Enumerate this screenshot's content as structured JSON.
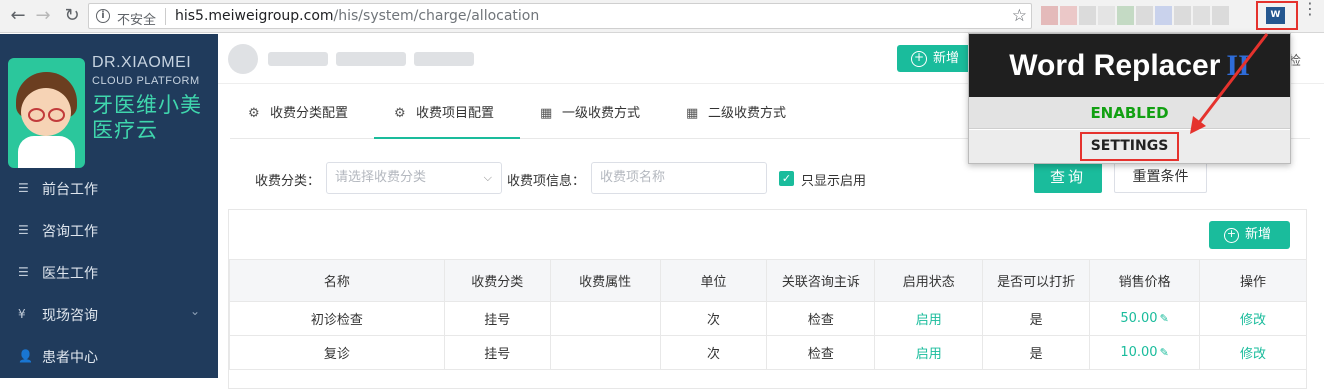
{
  "browser": {
    "back_icon": "←",
    "forward_icon": "→",
    "reload_icon": "↻",
    "info_icon": "i",
    "insecure_label": "不安全",
    "url_host": "his5.meiweigroup.com",
    "url_path": "/his/system/charge/allocation",
    "star_icon": "☆",
    "extension_icon": "W",
    "menu_icon": "⋮"
  },
  "brand": {
    "name_en_1": "DR.XIAOMEI",
    "name_en_2": "CLOUD PLATFORM",
    "name_cn_1": "牙医维小美",
    "name_cn_2": "医疗云"
  },
  "sidebar": {
    "items": [
      {
        "label": "前台工作",
        "icon": "list-icon"
      },
      {
        "label": "咨询工作",
        "icon": "list-icon"
      },
      {
        "label": "医生工作",
        "icon": "list-icon"
      },
      {
        "label": "现场咨询",
        "icon": "yen-icon"
      },
      {
        "label": "患者中心",
        "icon": "user-icon"
      }
    ]
  },
  "topbar": {
    "new_button": "新增",
    "right_text": "检"
  },
  "tabs": [
    {
      "label": "收费分类配置",
      "icon": "gear-icon",
      "active": false
    },
    {
      "label": "收费项目配置",
      "icon": "gear-icon",
      "active": true
    },
    {
      "label": "一级收费方式",
      "icon": "grid-icon",
      "active": false
    },
    {
      "label": "二级收费方式",
      "icon": "grid-icon",
      "active": false
    }
  ],
  "filters": {
    "category_label": "收费分类：",
    "category_placeholder": "请选择收费分类",
    "item_label": "收费项信息：",
    "item_placeholder": "收费项名称",
    "only_enabled_label": "只显示启用",
    "only_enabled_checked": true,
    "query_button": "查询",
    "reset_button": "重置条件"
  },
  "panel": {
    "add_button": "新增"
  },
  "table": {
    "headers": [
      "名称",
      "收费分类",
      "收费属性",
      "单位",
      "关联咨询主诉",
      "启用状态",
      "是否可以打折",
      "销售价格",
      "操作"
    ],
    "rows": [
      {
        "name": "初诊检查",
        "category": "挂号",
        "attribute": "",
        "unit": "次",
        "complaint": "检查",
        "status": "启用",
        "discount": "是",
        "price": "50.00",
        "action": "修改"
      },
      {
        "name": "复诊",
        "category": "挂号",
        "attribute": "",
        "unit": "次",
        "complaint": "检查",
        "status": "启用",
        "discount": "是",
        "price": "10.00",
        "action": "修改"
      }
    ]
  },
  "popup": {
    "title": "Word Replacer",
    "title_suffix": "II",
    "enabled_label": "ENABLED",
    "settings_label": "SETTINGS"
  },
  "colors": {
    "accent": "#1abc9c",
    "sidebar_bg": "#203b5c",
    "highlight_red": "#e5322d"
  }
}
